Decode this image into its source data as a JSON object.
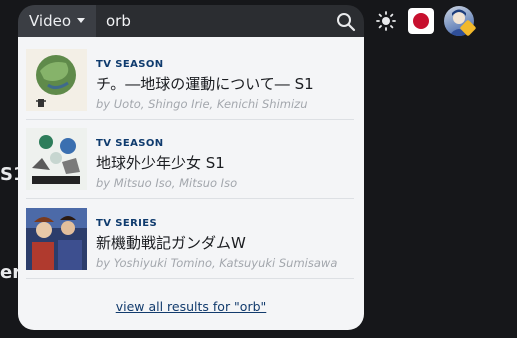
{
  "background": {
    "text_s1": "S1",
    "text_er": "er"
  },
  "search": {
    "type_label": "Video",
    "query": "orb",
    "search_icon": "search-icon"
  },
  "header": {
    "theme_icon": "sun-icon",
    "language_flag": "japan-flag-icon",
    "avatar": "user-avatar"
  },
  "results": [
    {
      "type": "TV SEASON",
      "title": "チ。―地球の運動について― S1",
      "authors": "by Uoto, Shingo Irie, Kenichi Shimizu"
    },
    {
      "type": "TV SEASON",
      "title": "地球外少年少女 S1",
      "authors": "by Mitsuo Iso, Mitsuo Iso"
    },
    {
      "type": "TV SERIES",
      "title": "新機動戦記ガンダムW",
      "authors": "by Yoshiyuki Tomino, Katsuyuki Sumisawa"
    }
  ],
  "view_all_label": "view all results for \"orb\"",
  "colors": {
    "page_bg": "#16171a",
    "searchbar_bg": "#2b2d31",
    "dropdown_bg": "#f4f5f7",
    "type_label": "#0f3b6e",
    "flag_red": "#c7102e"
  }
}
